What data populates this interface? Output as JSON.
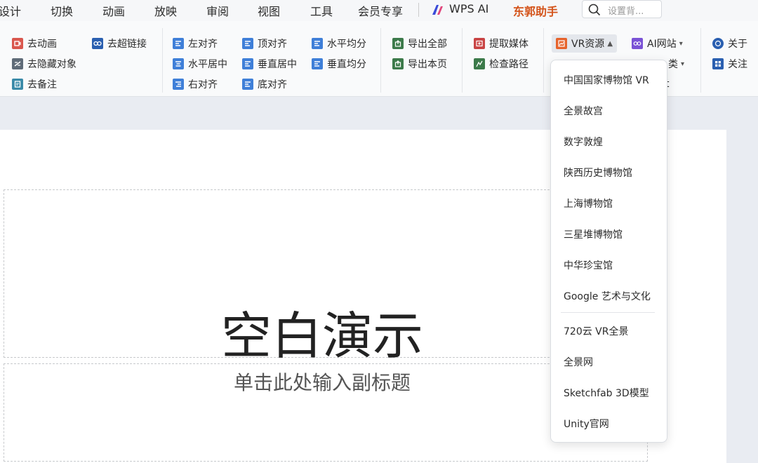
{
  "menu_tabs": [
    "设计",
    "切换",
    "动画",
    "放映",
    "审阅",
    "视图",
    "工具",
    "会员专享",
    "WPS AI",
    "东郭助手"
  ],
  "active_tab": "东郭助手",
  "search": {
    "placeholder": "设置背..."
  },
  "ribbon": {
    "remove_animation": "去动画",
    "remove_hidden_objects": "去隐藏对象",
    "remove_notes": "去备注",
    "remove_hyperlinks": "去超链接",
    "align_left": "左对齐",
    "align_h_center": "水平居中",
    "align_right": "右对齐",
    "align_top": "顶对齐",
    "align_v_center": "垂直居中",
    "align_bottom": "底对齐",
    "distribute_h": "水平均分",
    "distribute_v": "垂直均分",
    "export_all": "导出全部",
    "export_page": "导出本页",
    "extract_media": "提取媒体",
    "check_path": "检查路径",
    "vr_resources": "VR资源",
    "ai_sites": "AI网站",
    "category_partial": "类",
    "third_partial": "t",
    "about": "关于",
    "follow": "关注"
  },
  "vr_menu": [
    "中国国家博物馆 VR",
    "全景故宫",
    "数字敦煌",
    "陕西历史博物馆",
    "上海博物馆",
    "三星堆博物馆",
    "中华珍宝馆",
    "Google 艺术与文化",
    "720云 VR全景",
    "全景网",
    "Sketchfab 3D模型",
    "Unity官网"
  ],
  "slide": {
    "title": "空白演示",
    "subtitle": "单击此处输入副标题"
  },
  "colors": {
    "accent": "#d4541b",
    "vr_icon": "#e6632c",
    "ai_icon": "#7a52d6"
  }
}
